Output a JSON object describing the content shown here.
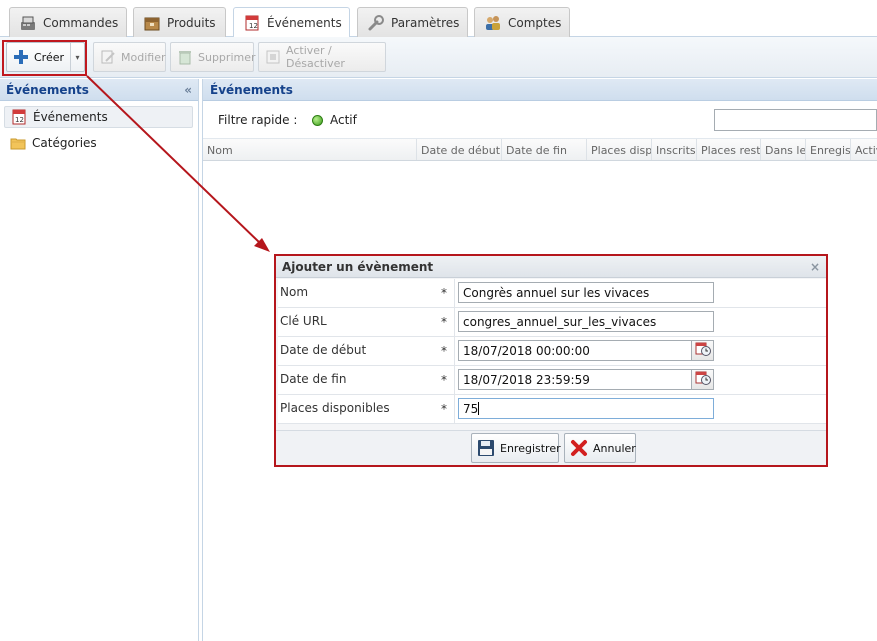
{
  "tabs": [
    {
      "label": "Commandes",
      "icon": "register-icon"
    },
    {
      "label": "Produits",
      "icon": "box-icon"
    },
    {
      "label": "Événements",
      "icon": "calendar-icon"
    },
    {
      "label": "Paramètres",
      "icon": "wrench-icon"
    },
    {
      "label": "Comptes",
      "icon": "users-icon"
    }
  ],
  "active_tab": "Événements",
  "toolbar": {
    "create_label": "Créer",
    "modify_label": "Modifier",
    "delete_label": "Supprimer",
    "toggle_label": "Activer / Désactiver"
  },
  "sidebar": {
    "title": "Événements",
    "collapse_glyph": "«",
    "items": [
      {
        "label": "Événements",
        "icon": "calendar-icon",
        "selected": true
      },
      {
        "label": "Catégories",
        "icon": "folder-icon",
        "selected": false
      }
    ]
  },
  "main": {
    "title": "Événements",
    "quick_filter_label": "Filtre rapide :",
    "quick_filter_value": "Actif",
    "search_value": "",
    "columns": [
      "Nom",
      "Date de début",
      "Date de fin",
      "Places dispo",
      "Inscrits",
      "Places resta",
      "Dans le",
      "Enregist",
      "Activ"
    ]
  },
  "dialog": {
    "title": "Ajouter un évènement",
    "close_glyph": "×",
    "fields": [
      {
        "label": "Nom",
        "required": "*",
        "value": "Congrès annuel sur les vivaces"
      },
      {
        "label": "Clé URL",
        "required": "*",
        "value": "congres_annuel_sur_les_vivaces"
      },
      {
        "label": "Date de début",
        "required": "*",
        "value": "18/07/2018 00:00:00"
      },
      {
        "label": "Date de fin",
        "required": "*",
        "value": "18/07/2018 23:59:59"
      },
      {
        "label": "Places disponibles",
        "required": "*",
        "value": "75"
      }
    ],
    "save_label": "Enregistrer",
    "cancel_label": "Annuler"
  },
  "colors": {
    "annotation_red": "#c0181e",
    "header_blue": "#15428b",
    "active_green": "#3a9a1a"
  }
}
